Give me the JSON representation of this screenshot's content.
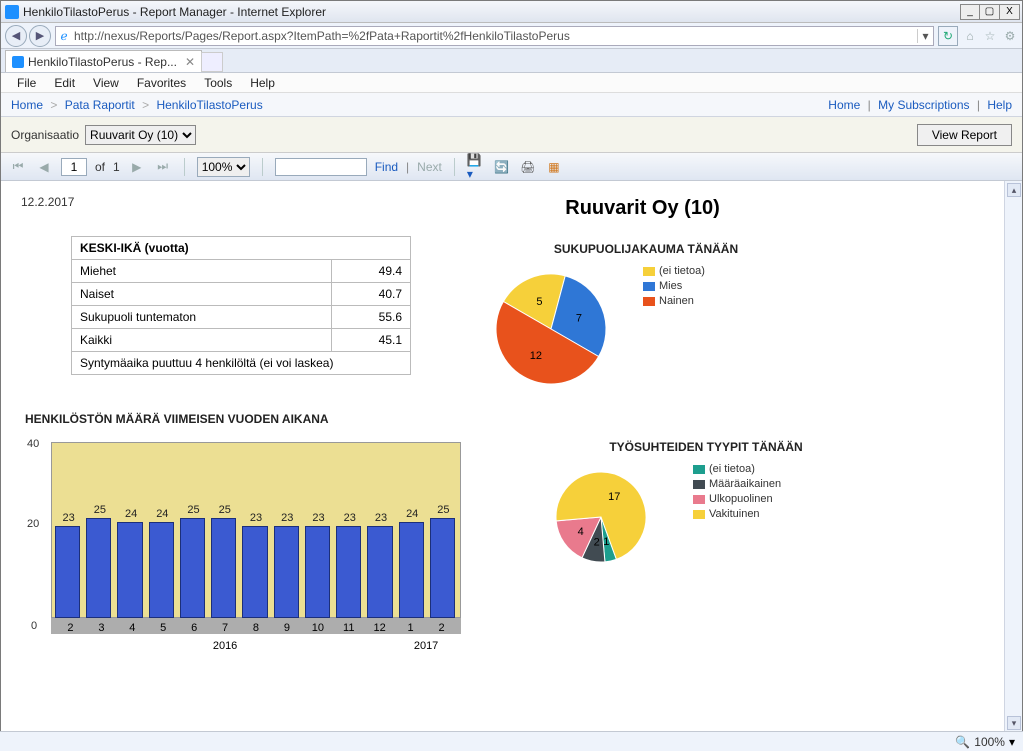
{
  "window": {
    "title": "HenkiloTilastoPerus - Report Manager - Internet Explorer",
    "min": "_",
    "max": "▢",
    "close": "X"
  },
  "addr": {
    "url": "http://nexus/Reports/Pages/Report.aspx?ItemPath=%2fPata+Raportit%2fHenkiloTilastoPerus"
  },
  "tab": {
    "label": "HenkiloTilastoPerus - Rep..."
  },
  "menu": [
    "File",
    "Edit",
    "View",
    "Favorites",
    "Tools",
    "Help"
  ],
  "breadcrumb": {
    "home": "Home",
    "mid": "Pata Raportit",
    "leaf": "HenkiloTilastoPerus",
    "right_home": "Home",
    "subs": "My Subscriptions",
    "help": "Help"
  },
  "param": {
    "label": "Organisaatio",
    "value": "Ruuvarit Oy (10)",
    "button": "View Report"
  },
  "toolbar": {
    "page_current": "1",
    "of": "of",
    "page_total": "1",
    "zoom": "100%",
    "find_placeholder": "",
    "find": "Find",
    "next": "Next"
  },
  "report": {
    "date": "12.2.2017",
    "title": "Ruuvarit Oy (10)",
    "age_header": "KESKI-IKÄ (vuotta)",
    "age_rows": [
      {
        "label": "Miehet",
        "value": "49.4"
      },
      {
        "label": "Naiset",
        "value": "40.7"
      },
      {
        "label": "Sukupuoli tuntematon",
        "value": "55.6"
      },
      {
        "label": "Kaikki",
        "value": "45.1"
      },
      {
        "label": "Syntymäaika puuttuu 4 henkilöltä (ei voi laskea)",
        "value": ""
      }
    ],
    "gender_title": "SUKUPUOLIJAKAUMA TÄNÄÄN",
    "gender_legend": [
      {
        "c": "#f6d03a",
        "t": "(ei tietoa)"
      },
      {
        "c": "#2f77d6",
        "t": "Mies"
      },
      {
        "c": "#e8521c",
        "t": "Nainen"
      }
    ],
    "emp_title": "TYÖSUHTEIDEN TYYPIT TÄNÄÄN",
    "emp_legend": [
      {
        "c": "#1d9e8e",
        "t": "(ei tietoa)"
      },
      {
        "c": "#414b52",
        "t": "Määräaikainen"
      },
      {
        "c": "#e97a8d",
        "t": "Ulkopuolinen"
      },
      {
        "c": "#f6d03a",
        "t": "Vakituinen"
      }
    ],
    "bar_title": "HENKILÖSTÖN MÄÄRÄ  VIIMEISEN VUODEN AIKANA",
    "year_a": "2016",
    "year_b": "2017"
  },
  "status": {
    "zoom": "100%"
  },
  "chart_data": [
    {
      "type": "pie",
      "title": "SUKUPUOLIJAKAUMA TÄNÄÄN",
      "series": [
        {
          "name": "(ei tietoa)",
          "value": 5,
          "color": "#f6d03a"
        },
        {
          "name": "Mies",
          "value": 7,
          "color": "#2f77d6"
        },
        {
          "name": "Nainen",
          "value": 12,
          "color": "#e8521c"
        }
      ]
    },
    {
      "type": "pie",
      "title": "TYÖSUHTEIDEN TYYPIT TÄNÄÄN",
      "series": [
        {
          "name": "(ei tietoa)",
          "value": 1,
          "color": "#1d9e8e"
        },
        {
          "name": "Määräaikainen",
          "value": 2,
          "color": "#414b52"
        },
        {
          "name": "Ulkopuolinen",
          "value": 4,
          "color": "#e97a8d"
        },
        {
          "name": "Vakituinen",
          "value": 17,
          "color": "#f6d03a"
        }
      ]
    },
    {
      "type": "bar",
      "title": "HENKILÖSTÖN MÄÄRÄ  VIIMEISEN VUODEN AIKANA",
      "categories": [
        "2",
        "3",
        "4",
        "5",
        "6",
        "7",
        "8",
        "9",
        "10",
        "11",
        "12",
        "1",
        "2"
      ],
      "year_groups": {
        "2016": [
          "2",
          "3",
          "4",
          "5",
          "6",
          "7",
          "8",
          "9",
          "10",
          "11",
          "12"
        ],
        "2017": [
          "1",
          "2"
        ]
      },
      "values": [
        23,
        25,
        24,
        24,
        25,
        25,
        23,
        23,
        23,
        23,
        23,
        24,
        25
      ],
      "ylabel": "",
      "ylim": [
        0,
        40
      ],
      "yticks": [
        0,
        20,
        40
      ]
    }
  ]
}
